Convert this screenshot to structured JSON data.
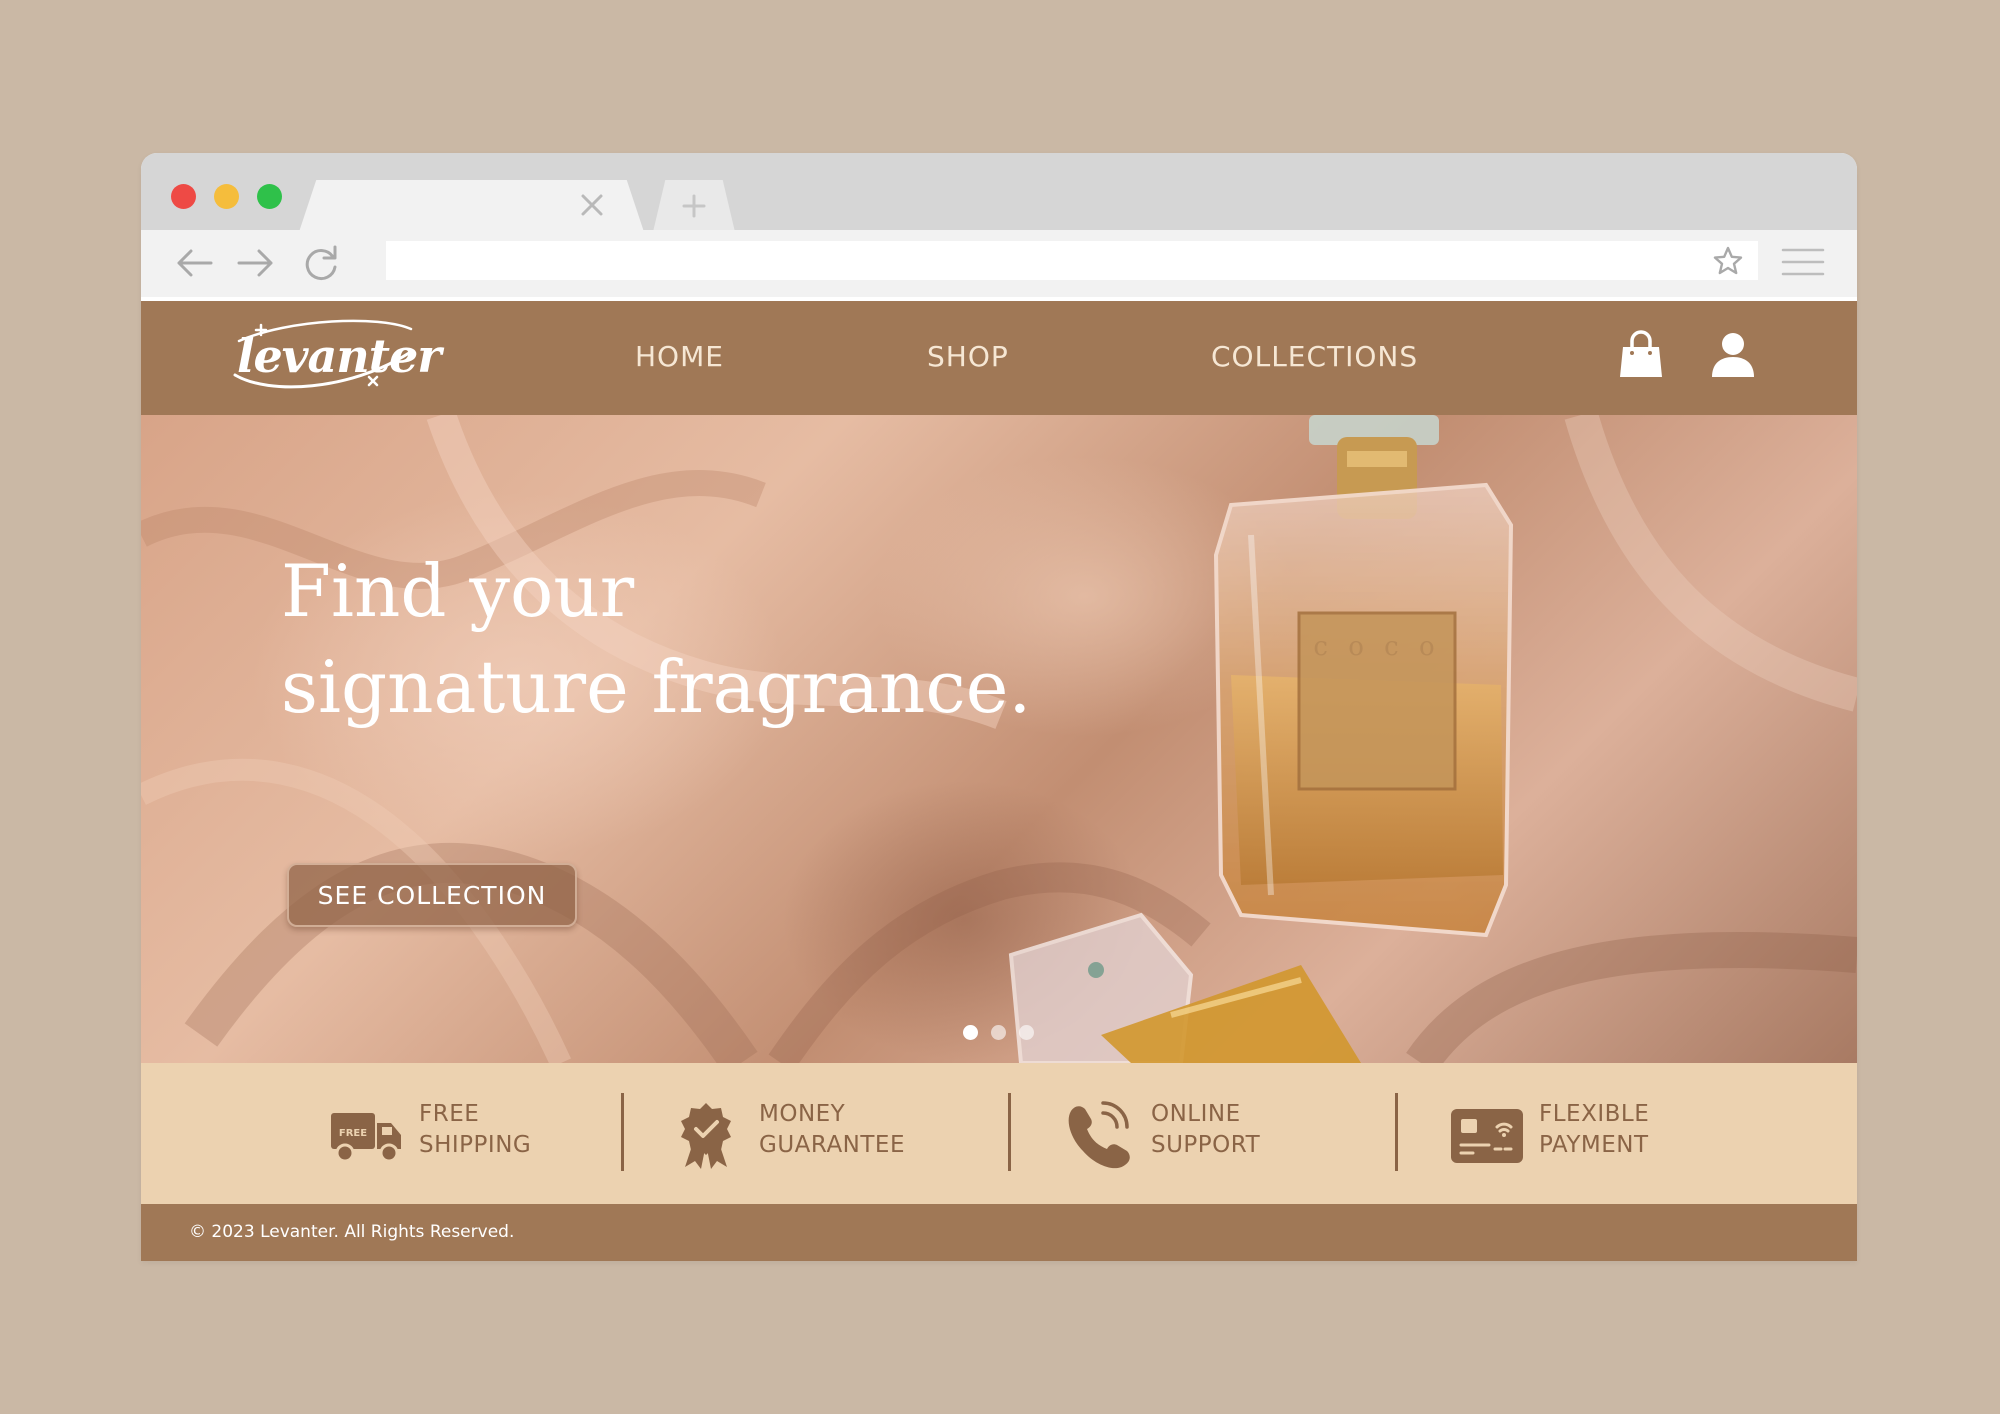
{
  "browser": {
    "tab_close_icon": "close-icon",
    "new_tab_icon": "plus-icon",
    "back_icon": "arrow-left-icon",
    "forward_icon": "arrow-right-icon",
    "reload_icon": "reload-icon",
    "url_value": "",
    "bookmark_icon": "star-icon",
    "menu_icon": "hamburger-icon",
    "traffic_lights": {
      "red": "#ee4a45",
      "yellow": "#f5bd3c",
      "green": "#2fc14a"
    }
  },
  "site": {
    "logo_text": "levanter",
    "nav": [
      "HOME",
      "SHOP",
      "COLLECTIONS"
    ],
    "cart_icon": "shopping-bag-icon",
    "account_icon": "user-icon",
    "colors": {
      "brand_brown": "#a07856",
      "cream": "#ecd2b0",
      "text_brown": "#8a6446",
      "nav_text": "#f6e7d4"
    }
  },
  "hero": {
    "title_line1": "Find your",
    "title_line2": "signature fragrance.",
    "cta_label": "SEE COLLECTION",
    "slides_total": 3,
    "active_slide": 1
  },
  "features": [
    {
      "icon": "truck-icon",
      "icon_label": "FREE",
      "line1": "FREE",
      "line2": "SHIPPING"
    },
    {
      "icon": "award-badge-icon",
      "line1": "MONEY",
      "line2": "GUARANTEE"
    },
    {
      "icon": "phone-icon",
      "line1": "ONLINE",
      "line2": "SUPPORT"
    },
    {
      "icon": "card-payment-icon",
      "line1": "FLEXIBLE",
      "line2": "PAYMENT"
    }
  ],
  "footer": {
    "copyright": "© 2023 Levanter. All Rights Reserved."
  }
}
